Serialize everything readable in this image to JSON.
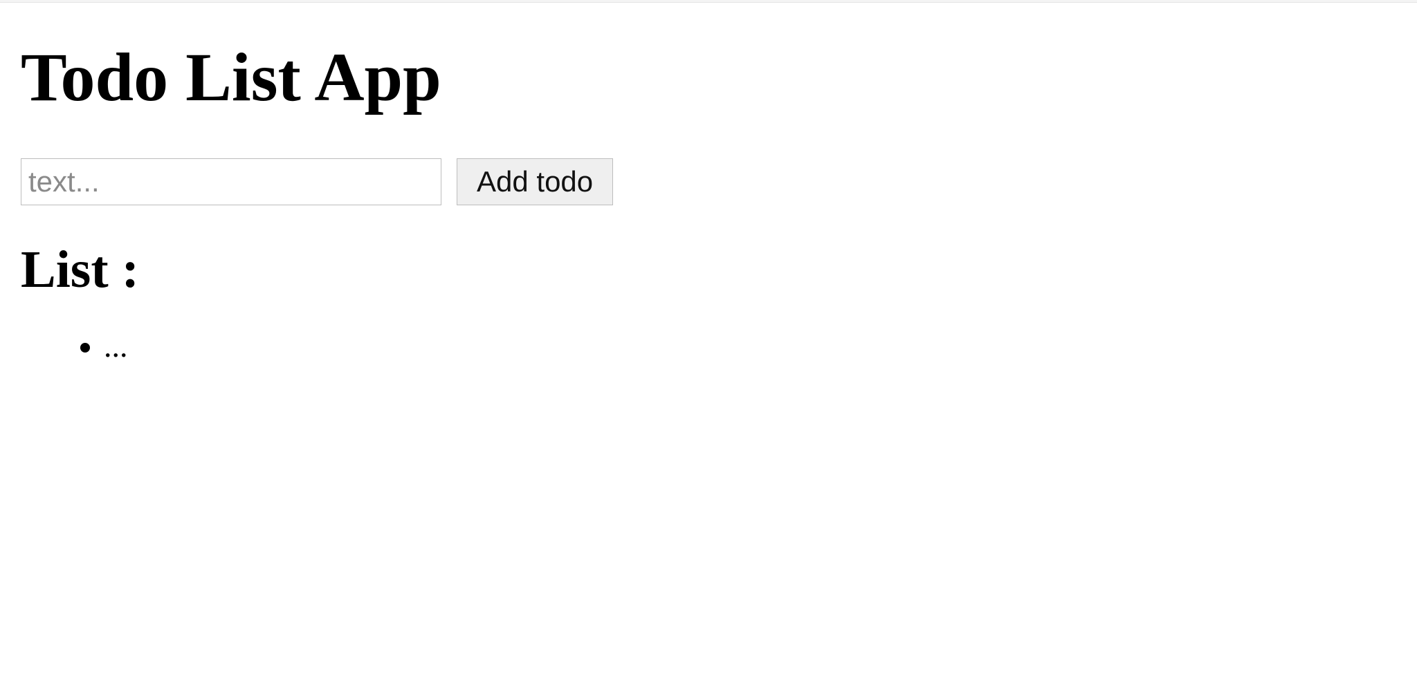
{
  "header": {
    "title": "Todo List App"
  },
  "form": {
    "input_value": "",
    "input_placeholder": "text...",
    "add_button_label": "Add todo"
  },
  "list": {
    "heading": "List :",
    "items": [
      {
        "text": "..."
      }
    ]
  }
}
